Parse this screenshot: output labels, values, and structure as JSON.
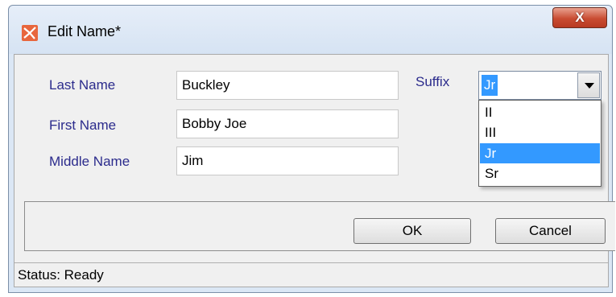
{
  "window": {
    "title": "Edit Name*",
    "close_label": "X",
    "icon": "app-logo-icon"
  },
  "form": {
    "last_name": {
      "label": "Last Name",
      "value": "Buckley"
    },
    "first_name": {
      "label": "First Name",
      "value": "Bobby Joe"
    },
    "middle_name": {
      "label": "Middle Name",
      "value": "Jim"
    },
    "suffix": {
      "label": "Suffix",
      "selected": "Jr",
      "options": [
        "II",
        "III",
        "Jr",
        "Sr"
      ]
    }
  },
  "buttons": {
    "ok_label": "OK",
    "cancel_label": "Cancel"
  },
  "status": {
    "text": "Status: Ready"
  },
  "colors": {
    "label_text": "#2b2b8c",
    "selection": "#3399ff",
    "close_button": "#c94c32"
  }
}
